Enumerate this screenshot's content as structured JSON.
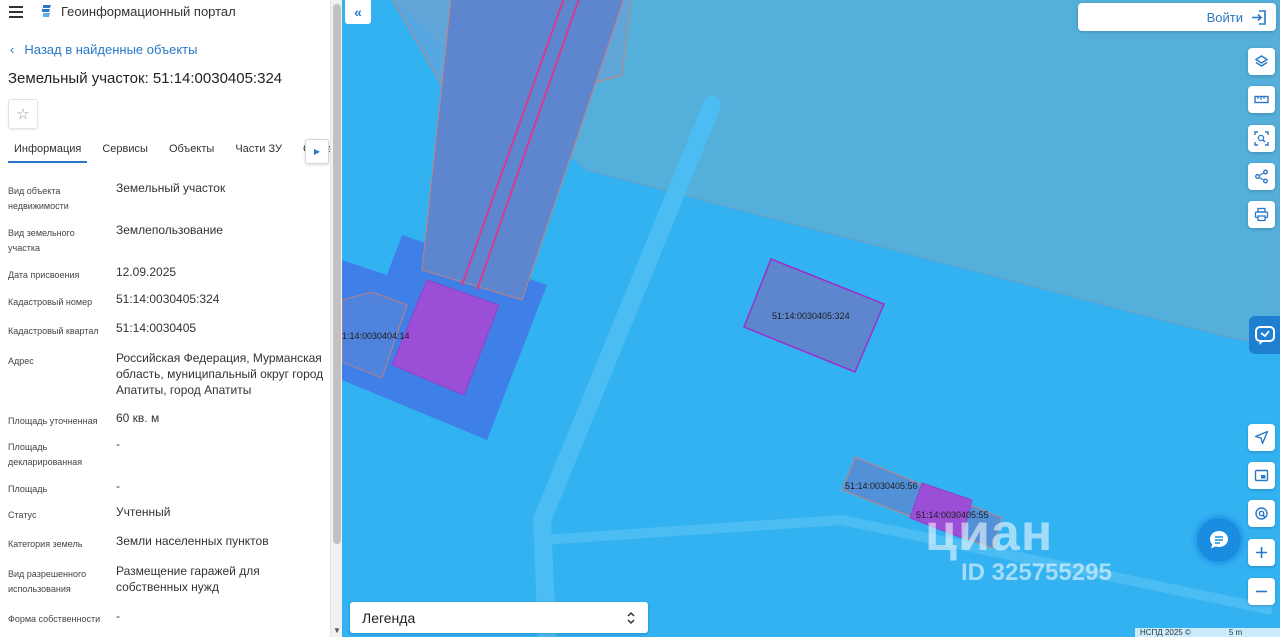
{
  "app": {
    "title": "Геоинформационный портал"
  },
  "nav": {
    "back_label": "Назад в найденные объекты"
  },
  "object": {
    "title": "Земельный участок: 51:14:0030405:324"
  },
  "tabs": [
    {
      "label": "Информация"
    },
    {
      "label": "Сервисы"
    },
    {
      "label": "Объекты"
    },
    {
      "label": "Части ЗУ"
    },
    {
      "label": "Соста"
    }
  ],
  "tab_overflow_fragment": "я",
  "fields": [
    {
      "label": "Вид объекта недвижимости",
      "value": "Земельный участок"
    },
    {
      "label": "Вид земельного участка",
      "value": "Землепользование"
    },
    {
      "label": "Дата присвоения",
      "value": "12.09.2025"
    },
    {
      "label": "Кадастровый номер",
      "value": "51:14:0030405:324"
    },
    {
      "label": "Кадастровый квартал",
      "value": "51:14:0030405"
    },
    {
      "label": "Адрес",
      "value": "Российская Федерация, Мурманская область, муниципальный округ город Апатиты, город Апатиты"
    },
    {
      "label": "Площадь уточненная",
      "value": "60 кв. м"
    },
    {
      "label": "Площадь декларированная",
      "value": "-"
    },
    {
      "label": "Площадь",
      "value": "-"
    },
    {
      "label": "Статус",
      "value": "Учтенный"
    },
    {
      "label": "Категория земель",
      "value": "Земли населенных пунктов"
    },
    {
      "label": "Вид разрешенного использования",
      "value": "Размещение гаражей для собственных нужд"
    },
    {
      "label": "Форма собственности",
      "value": "-"
    }
  ],
  "map": {
    "login_label": "Войти",
    "legend_label": "Легенда",
    "parcel_labels": {
      "main": "51:14:0030405:324",
      "left": "1:14:0030404:14",
      "p56": "51:14:0030405:56",
      "p55": "51:14:0030405:55"
    },
    "attribution": "НСПД 2025 ©",
    "scale_label": "5 m",
    "watermark": {
      "brand": "циан",
      "id": "ID 325755295"
    },
    "colors": {
      "background": "#33b2f2",
      "accent": "#2a78c7",
      "parcel_fill": "#5e86cf",
      "highlight": "#9b4fd6"
    }
  },
  "icons": {
    "menu": "menu-icon",
    "logo": "portal-logo-icon",
    "back": "chevron-left-icon",
    "favorite": "star-icon",
    "tabs_next": "chevron-right-icon",
    "collapse": "double-chevron-left-icon",
    "login": "login-icon",
    "tools": [
      "layers-icon",
      "ruler-icon",
      "select-area-icon",
      "share-icon",
      "print-icon",
      "locate-icon",
      "minimap-icon",
      "geo-pin-icon",
      "zoom-in-icon",
      "zoom-out-icon"
    ],
    "chat": "chat-icon",
    "legend_toggle": "chevron-updown-icon"
  }
}
